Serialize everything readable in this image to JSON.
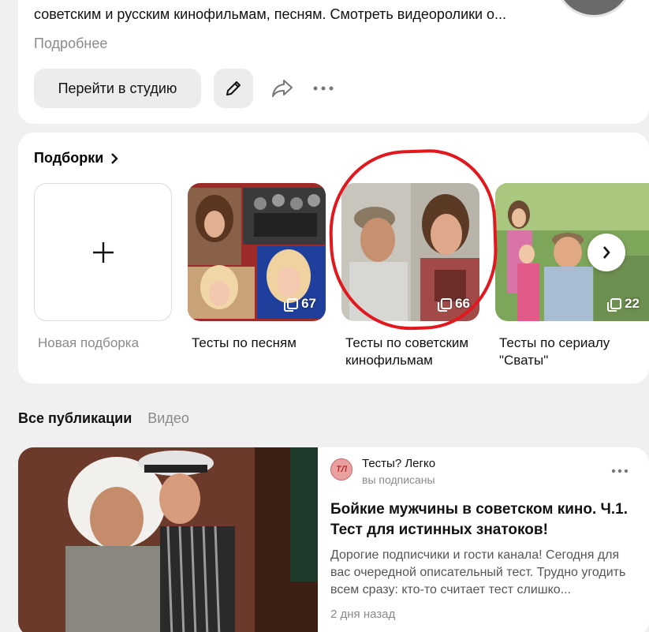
{
  "channel": {
    "description": "советским и русским кинофильмам, песням. Смотреть видеоролики о...",
    "more_label": "Подробнее",
    "studio_button": "Перейти в студию",
    "icons": {
      "edit": "pencil-icon",
      "share": "share-icon",
      "more": "more-horizontal-icon"
    }
  },
  "collections": {
    "title": "Подборки",
    "items": [
      {
        "label": "Новая подборка",
        "icon": "plus-icon"
      },
      {
        "label": "Тесты по песням",
        "count": "67"
      },
      {
        "label": "Тесты по советским кинофильмам",
        "count": "66"
      },
      {
        "label": "Тесты по сериалу \"Сваты\"",
        "count": "22"
      }
    ],
    "next_icon": "chevron-right-icon",
    "highlight_color": "#e2181f"
  },
  "feed": {
    "tabs": [
      "Все публикации",
      "Видео"
    ],
    "post": {
      "channel_name": "Тесты? Легко",
      "subscription": "вы подписаны",
      "title": "Бойкие мужчины в советском кино. Ч.1. Тест для истинных знатоков!",
      "excerpt": "Дорогие подписчики и гости канала! Сегодня для вас очередной описательный тест. Трудно угодить всем сразу: кто-то считает тест слишко...",
      "date": "2 дня назад"
    }
  }
}
